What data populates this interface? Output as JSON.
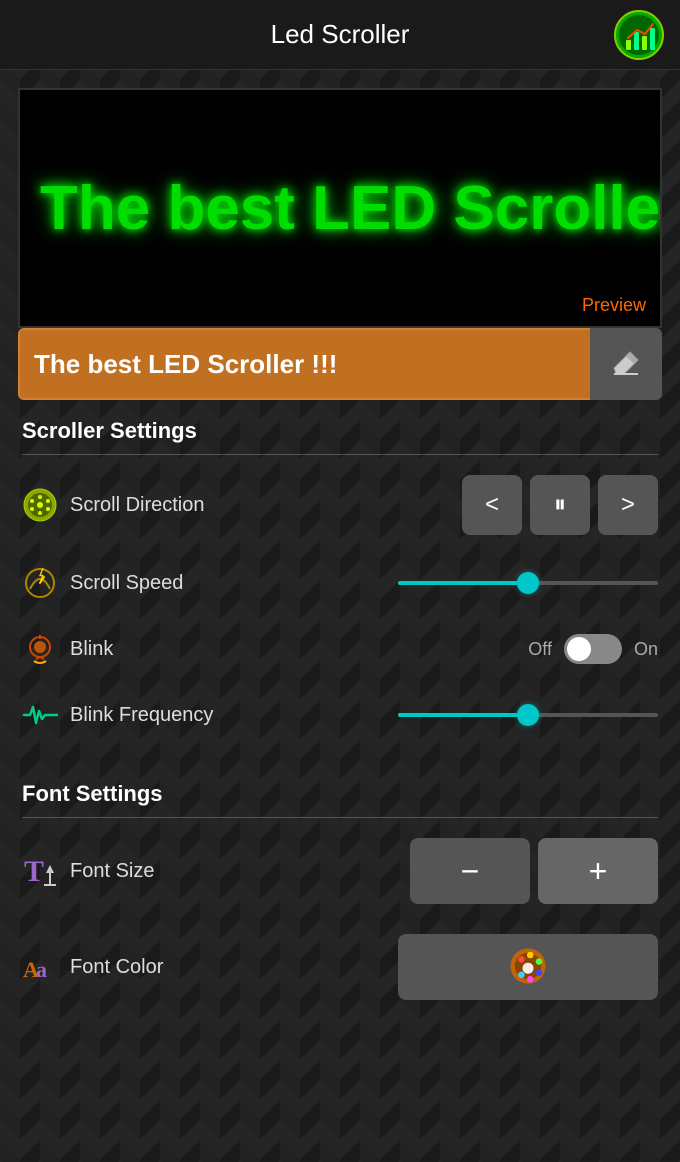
{
  "header": {
    "title": "Led Scroller",
    "icon_name": "analytics-icon"
  },
  "preview": {
    "led_text": "The best LED Scroller !!!",
    "preview_label": "Preview"
  },
  "input_bar": {
    "text_value": "The best LED Scroller !!!",
    "clear_button_label": "Clear"
  },
  "scroller_settings": {
    "section_title": "Scroller Settings",
    "scroll_direction": {
      "label": "Scroll Direction",
      "icon_name": "scroll-direction-icon",
      "left_button": "<",
      "pause_button": "⏸",
      "right_button": ">"
    },
    "scroll_speed": {
      "label": "Scroll Speed",
      "icon_name": "scroll-speed-icon",
      "value": 50
    },
    "blink": {
      "label": "Blink",
      "icon_name": "blink-icon",
      "off_label": "Off",
      "on_label": "On",
      "state": false
    },
    "blink_frequency": {
      "label": "Blink Frequency",
      "icon_name": "blink-frequency-icon",
      "value": 50
    }
  },
  "font_settings": {
    "section_title": "Font Settings",
    "font_size": {
      "label": "Font Size",
      "icon_name": "font-size-icon",
      "minus_label": "−",
      "plus_label": "+"
    },
    "font_color": {
      "label": "Font Color",
      "icon_name": "font-color-icon",
      "palette_icon": "palette-icon"
    }
  }
}
